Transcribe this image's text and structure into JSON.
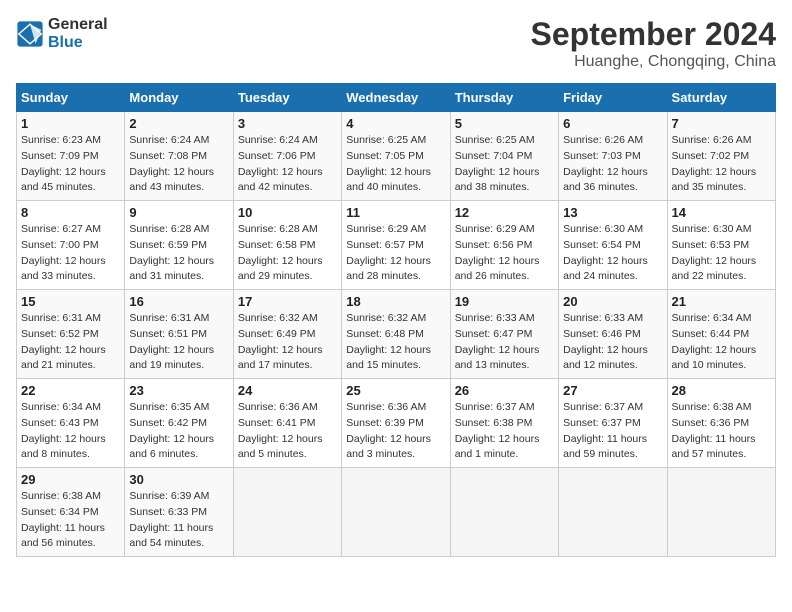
{
  "header": {
    "logo_line1": "General",
    "logo_line2": "Blue",
    "month_year": "September 2024",
    "location": "Huanghe, Chongqing, China"
  },
  "weekdays": [
    "Sunday",
    "Monday",
    "Tuesday",
    "Wednesday",
    "Thursday",
    "Friday",
    "Saturday"
  ],
  "weeks": [
    [
      {
        "day": "1",
        "sunrise": "6:23 AM",
        "sunset": "7:09 PM",
        "daylight": "12 hours and 45 minutes."
      },
      {
        "day": "2",
        "sunrise": "6:24 AM",
        "sunset": "7:08 PM",
        "daylight": "12 hours and 43 minutes."
      },
      {
        "day": "3",
        "sunrise": "6:24 AM",
        "sunset": "7:06 PM",
        "daylight": "12 hours and 42 minutes."
      },
      {
        "day": "4",
        "sunrise": "6:25 AM",
        "sunset": "7:05 PM",
        "daylight": "12 hours and 40 minutes."
      },
      {
        "day": "5",
        "sunrise": "6:25 AM",
        "sunset": "7:04 PM",
        "daylight": "12 hours and 38 minutes."
      },
      {
        "day": "6",
        "sunrise": "6:26 AM",
        "sunset": "7:03 PM",
        "daylight": "12 hours and 36 minutes."
      },
      {
        "day": "7",
        "sunrise": "6:26 AM",
        "sunset": "7:02 PM",
        "daylight": "12 hours and 35 minutes."
      }
    ],
    [
      {
        "day": "8",
        "sunrise": "6:27 AM",
        "sunset": "7:00 PM",
        "daylight": "12 hours and 33 minutes."
      },
      {
        "day": "9",
        "sunrise": "6:28 AM",
        "sunset": "6:59 PM",
        "daylight": "12 hours and 31 minutes."
      },
      {
        "day": "10",
        "sunrise": "6:28 AM",
        "sunset": "6:58 PM",
        "daylight": "12 hours and 29 minutes."
      },
      {
        "day": "11",
        "sunrise": "6:29 AM",
        "sunset": "6:57 PM",
        "daylight": "12 hours and 28 minutes."
      },
      {
        "day": "12",
        "sunrise": "6:29 AM",
        "sunset": "6:56 PM",
        "daylight": "12 hours and 26 minutes."
      },
      {
        "day": "13",
        "sunrise": "6:30 AM",
        "sunset": "6:54 PM",
        "daylight": "12 hours and 24 minutes."
      },
      {
        "day": "14",
        "sunrise": "6:30 AM",
        "sunset": "6:53 PM",
        "daylight": "12 hours and 22 minutes."
      }
    ],
    [
      {
        "day": "15",
        "sunrise": "6:31 AM",
        "sunset": "6:52 PM",
        "daylight": "12 hours and 21 minutes."
      },
      {
        "day": "16",
        "sunrise": "6:31 AM",
        "sunset": "6:51 PM",
        "daylight": "12 hours and 19 minutes."
      },
      {
        "day": "17",
        "sunrise": "6:32 AM",
        "sunset": "6:49 PM",
        "daylight": "12 hours and 17 minutes."
      },
      {
        "day": "18",
        "sunrise": "6:32 AM",
        "sunset": "6:48 PM",
        "daylight": "12 hours and 15 minutes."
      },
      {
        "day": "19",
        "sunrise": "6:33 AM",
        "sunset": "6:47 PM",
        "daylight": "12 hours and 13 minutes."
      },
      {
        "day": "20",
        "sunrise": "6:33 AM",
        "sunset": "6:46 PM",
        "daylight": "12 hours and 12 minutes."
      },
      {
        "day": "21",
        "sunrise": "6:34 AM",
        "sunset": "6:44 PM",
        "daylight": "12 hours and 10 minutes."
      }
    ],
    [
      {
        "day": "22",
        "sunrise": "6:34 AM",
        "sunset": "6:43 PM",
        "daylight": "12 hours and 8 minutes."
      },
      {
        "day": "23",
        "sunrise": "6:35 AM",
        "sunset": "6:42 PM",
        "daylight": "12 hours and 6 minutes."
      },
      {
        "day": "24",
        "sunrise": "6:36 AM",
        "sunset": "6:41 PM",
        "daylight": "12 hours and 5 minutes."
      },
      {
        "day": "25",
        "sunrise": "6:36 AM",
        "sunset": "6:39 PM",
        "daylight": "12 hours and 3 minutes."
      },
      {
        "day": "26",
        "sunrise": "6:37 AM",
        "sunset": "6:38 PM",
        "daylight": "12 hours and 1 minute."
      },
      {
        "day": "27",
        "sunrise": "6:37 AM",
        "sunset": "6:37 PM",
        "daylight": "11 hours and 59 minutes."
      },
      {
        "day": "28",
        "sunrise": "6:38 AM",
        "sunset": "6:36 PM",
        "daylight": "11 hours and 57 minutes."
      }
    ],
    [
      {
        "day": "29",
        "sunrise": "6:38 AM",
        "sunset": "6:34 PM",
        "daylight": "11 hours and 56 minutes."
      },
      {
        "day": "30",
        "sunrise": "6:39 AM",
        "sunset": "6:33 PM",
        "daylight": "11 hours and 54 minutes."
      },
      null,
      null,
      null,
      null,
      null
    ]
  ],
  "labels": {
    "sunrise": "Sunrise:",
    "sunset": "Sunset:",
    "daylight": "Daylight:"
  }
}
